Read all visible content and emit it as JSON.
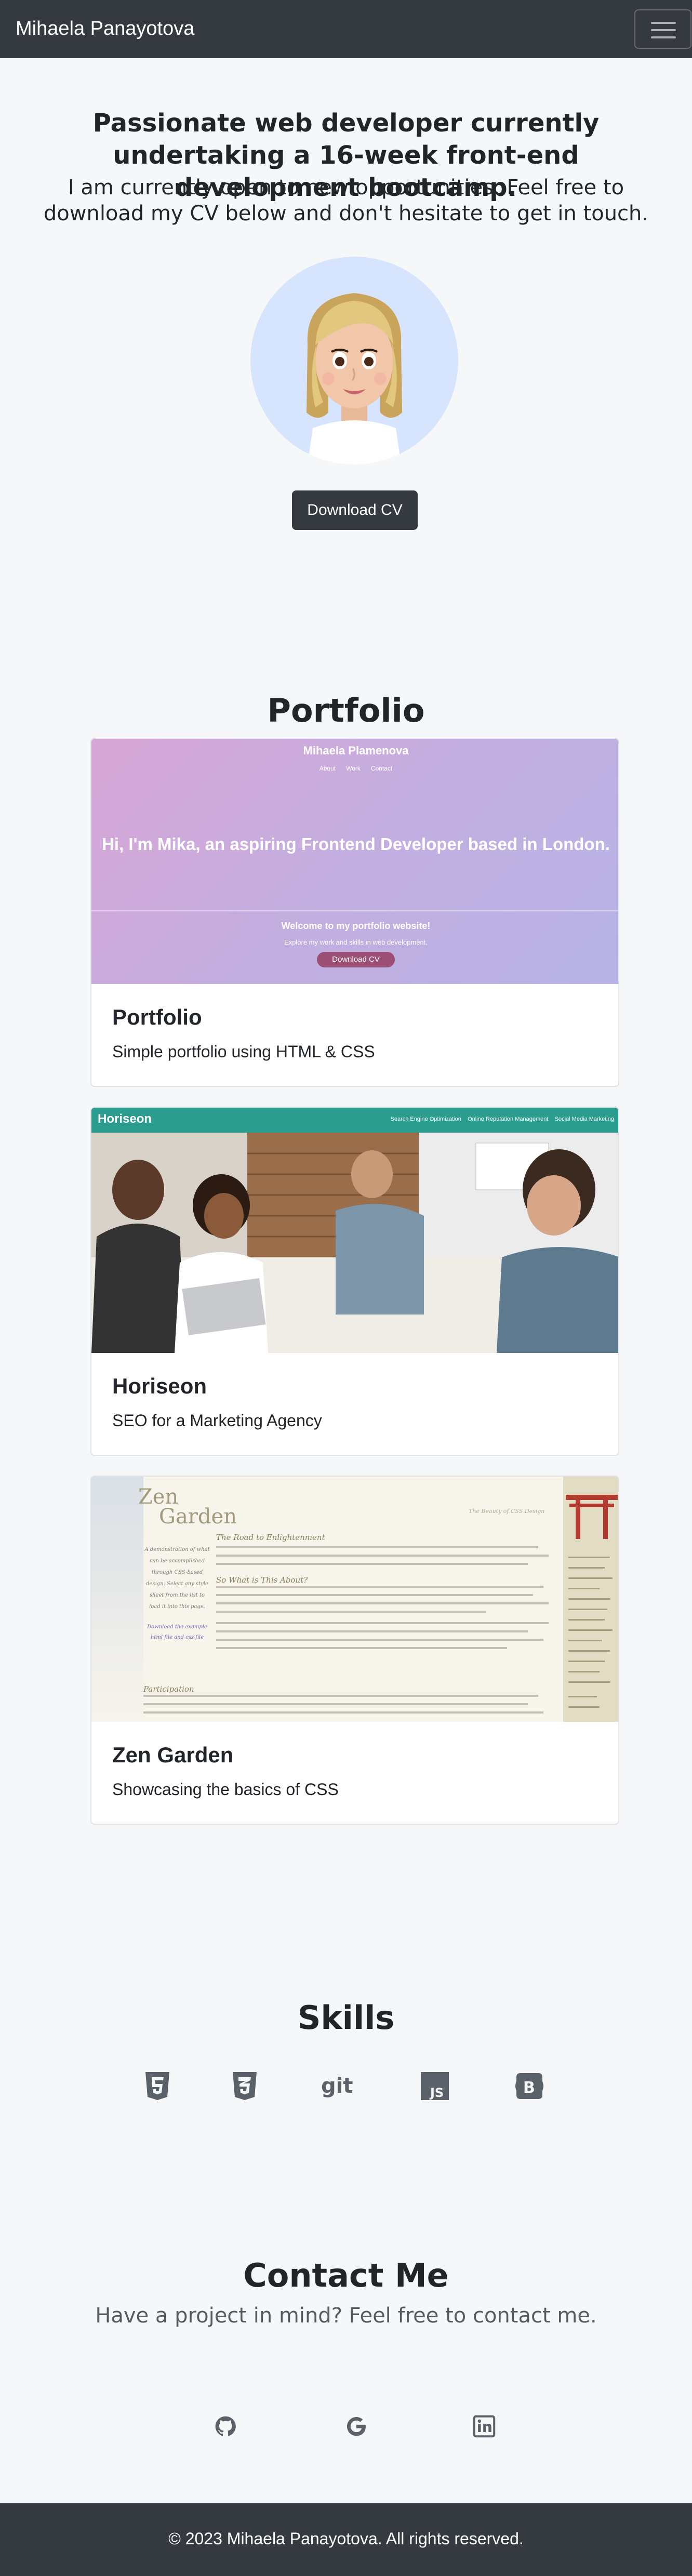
{
  "navbar": {
    "brand": "Mihaela Panayotova",
    "toggle_icon": "hamburger-menu-icon"
  },
  "hero": {
    "title": "Passionate web developer currently undertaking a 16-week front-end development bootcamp.",
    "subtitle": "I am currently open to new opportunities. Feel free to download my CV below and don't hesitate to get in touch.",
    "avatar_icon": "memoji-avatar",
    "cv_button": "Download CV"
  },
  "portfolio": {
    "heading": "Portfolio",
    "cards": [
      {
        "title": "Portfolio",
        "text": "Simple portfolio using HTML & CSS",
        "preview": {
          "site_name": "Mihaela Plamenova",
          "nav": [
            "About",
            "Work",
            "Contact"
          ],
          "headline": "Hi, I'm Mika, an aspiring Frontend Developer based in London.",
          "welcome": "Welcome to my portfolio website!",
          "explore": "Explore my work and skills in web development.",
          "button": "Download CV"
        }
      },
      {
        "title": "Horiseon",
        "text": "SEO for a Marketing Agency",
        "preview": {
          "logo": "Horiseon",
          "nav": [
            "Search Engine Optimization",
            "Online Reputation Management",
            "Social Media Marketing"
          ]
        }
      },
      {
        "title": "Zen Garden",
        "text": "Showcasing the basics of CSS",
        "preview": {
          "title_line1": "Zen",
          "title_line2": "Garden",
          "tagline": "The Beauty of CSS Design",
          "heading1": "The Road to Enlightenment",
          "heading2": "So What is This About?",
          "heading3": "Participation",
          "left_text": "A demonstration of what can be accomplished through CSS-based design. Select any style sheet from the list to load it into this page.",
          "left_link": "Download the example html file and css file"
        }
      }
    ]
  },
  "skills": {
    "heading": "Skills",
    "icons": [
      "html5-icon",
      "css3-icon",
      "git-icon",
      "javascript-icon",
      "bootstrap-icon"
    ]
  },
  "contact": {
    "heading": "Contact Me",
    "subtitle": "Have a project in mind? Feel free to contact me.",
    "icons": [
      "github-icon",
      "google-icon",
      "linkedin-icon"
    ]
  },
  "footer": {
    "text": "© 2023 Mihaela Panayotova. All rights reserved."
  },
  "colors": {
    "navbar": "#343a40",
    "background": "#f6f7f9",
    "avatar_bg": "#d6e4fd",
    "icon": "#5a6169"
  }
}
